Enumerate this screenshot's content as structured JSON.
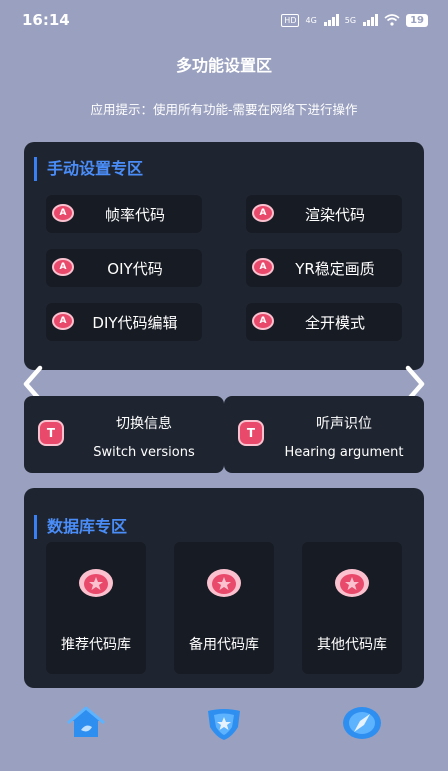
{
  "status_bar": {
    "time": "16:14",
    "hd": "HD",
    "net1": "4G",
    "net2": "5G",
    "battery": "19"
  },
  "page_title": "多功能设置区",
  "tip": "应用提示：使用所有功能-需要在网络下进行操作",
  "manual_section": {
    "title": "手动设置专区",
    "badge": "A",
    "buttons": [
      {
        "label": "帧率代码"
      },
      {
        "label": "渲染代码"
      },
      {
        "label": "OIY代码"
      },
      {
        "label": "YR稳定画质"
      },
      {
        "label": "DIY代码编辑"
      },
      {
        "label": "全开模式"
      }
    ]
  },
  "switch_cards": [
    {
      "badge": "T",
      "cn": "切换信息",
      "en": "Switch versions"
    },
    {
      "badge": "T",
      "cn": "听声识位",
      "en": "Hearing argument"
    }
  ],
  "db_section": {
    "title": "数据库专区",
    "tiles": [
      {
        "label": "推荐代码库"
      },
      {
        "label": "备用代码库"
      },
      {
        "label": "其他代码库"
      }
    ]
  },
  "colors": {
    "background": "#9aa0bf",
    "card": "#1f2530",
    "accent_blue": "#3b7ff5",
    "badge_pink": "#e94a6b"
  },
  "icons": [
    "left-arrow-icon",
    "right-arrow-icon",
    "home-icon",
    "shield-icon",
    "compass-icon",
    "medal-icon"
  ]
}
